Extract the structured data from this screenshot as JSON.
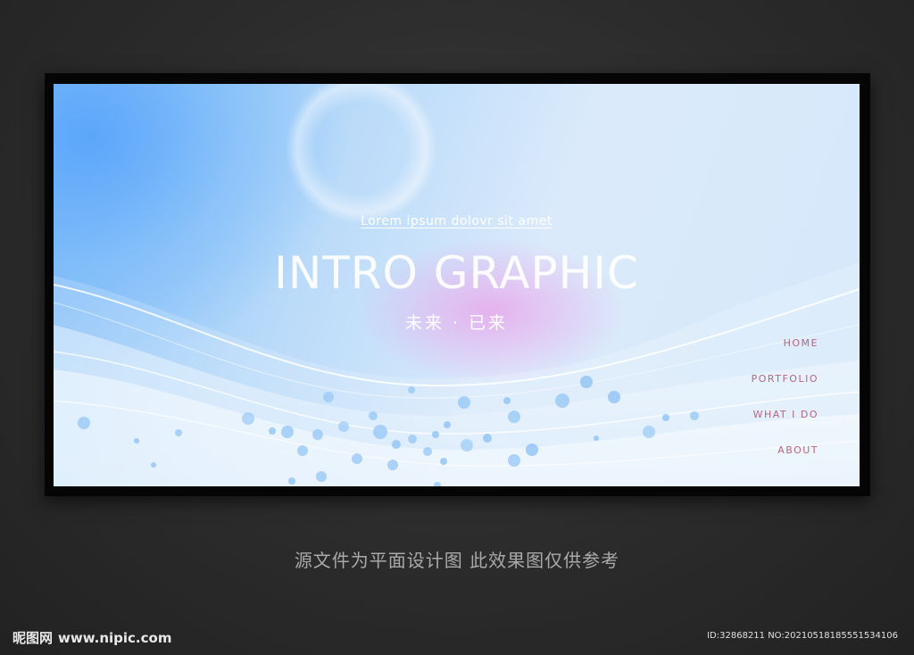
{
  "hero": {
    "subtitle": "Lorem ipsum dolovr sit amet",
    "title": "INTRO GRAPHIC",
    "tagline": "未来 · 已来"
  },
  "nav": {
    "items": [
      {
        "label": "HOME"
      },
      {
        "label": "PORTFOLIO"
      },
      {
        "label": "WHAT I DO"
      },
      {
        "label": "ABOUT"
      }
    ]
  },
  "caption": "源文件为平面设计图 此效果图仅供参考",
  "watermark": {
    "brand": "昵图网",
    "url": "www.nipic.com",
    "id_text": "ID:32868211 NO:20210518185551534106"
  },
  "colors": {
    "nav_text": "#b5667f",
    "accent_blue": "#78b8f7",
    "accent_pink": "#e8a8ec"
  }
}
